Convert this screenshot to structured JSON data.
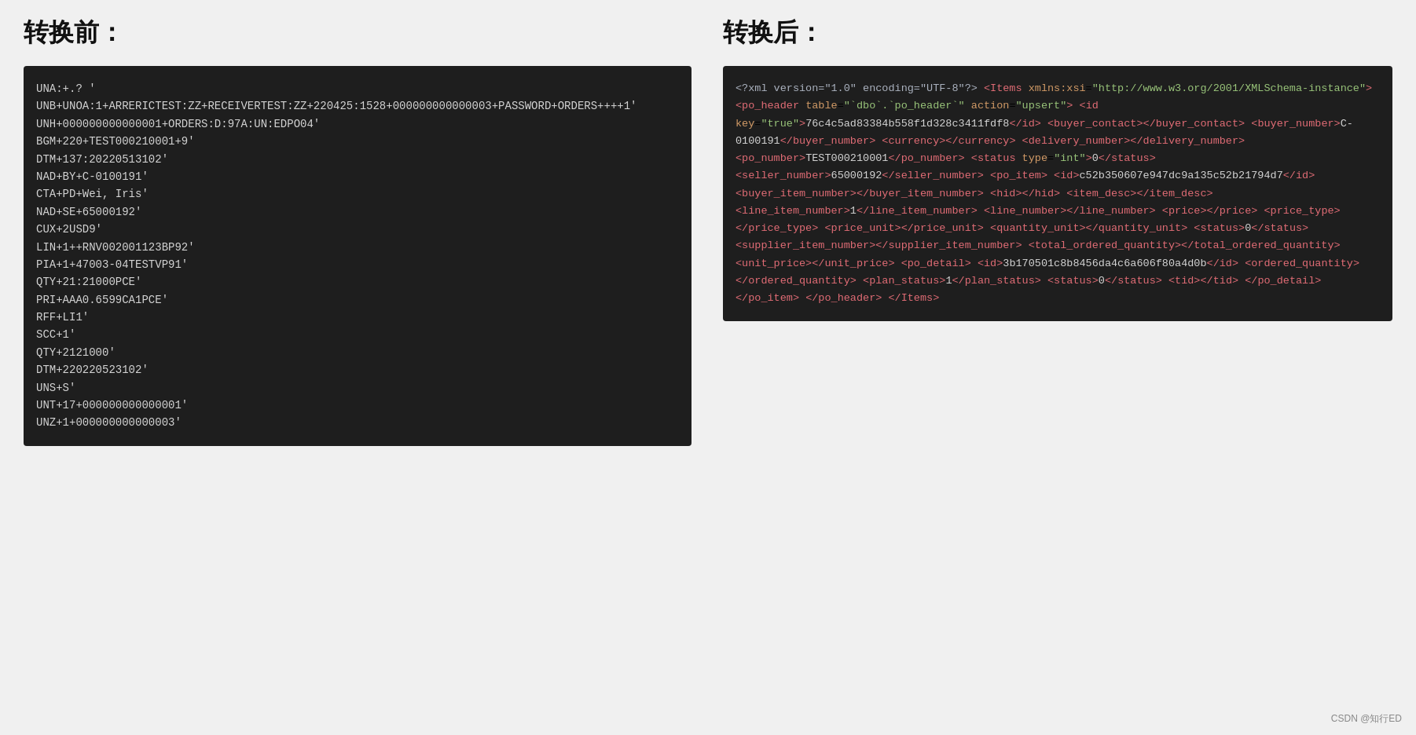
{
  "left": {
    "title": "转换前：",
    "code_lines": [
      "UNA:+.? '",
      "UNB+UNOA:1+ARRERICTEST:ZZ+RECEIVERTEST:ZZ+220425:1528+000000000000003+PASSWORD+ORDERS++++1'",
      "UNH+000000000000001+ORDERS:D:97A:UN:EDPO04'",
      "BGM+220+TEST000210001+9'",
      "DTM+137:20220513102'",
      "NAD+BY+C-0100191'",
      "CTA+PD+Wei, Iris'",
      "NAD+SE+65000192'",
      "CUX+2USD9'",
      "LIN+1++RNV002001123BP92'",
      "PIA+1+47003-04TESTVP91'",
      "QTY+21:21000PCE'",
      "PRI+AAA0.6599CA1PCE'",
      "RFF+LI1'",
      "SCC+1'",
      "QTY+2121000'",
      "DTM+220220523102'",
      "UNS+S'",
      "UNT+17+000000000000001'",
      "UNZ+1+000000000000003'"
    ]
  },
  "right": {
    "title": "转换后："
  },
  "watermark": "CSDN @知行ED"
}
